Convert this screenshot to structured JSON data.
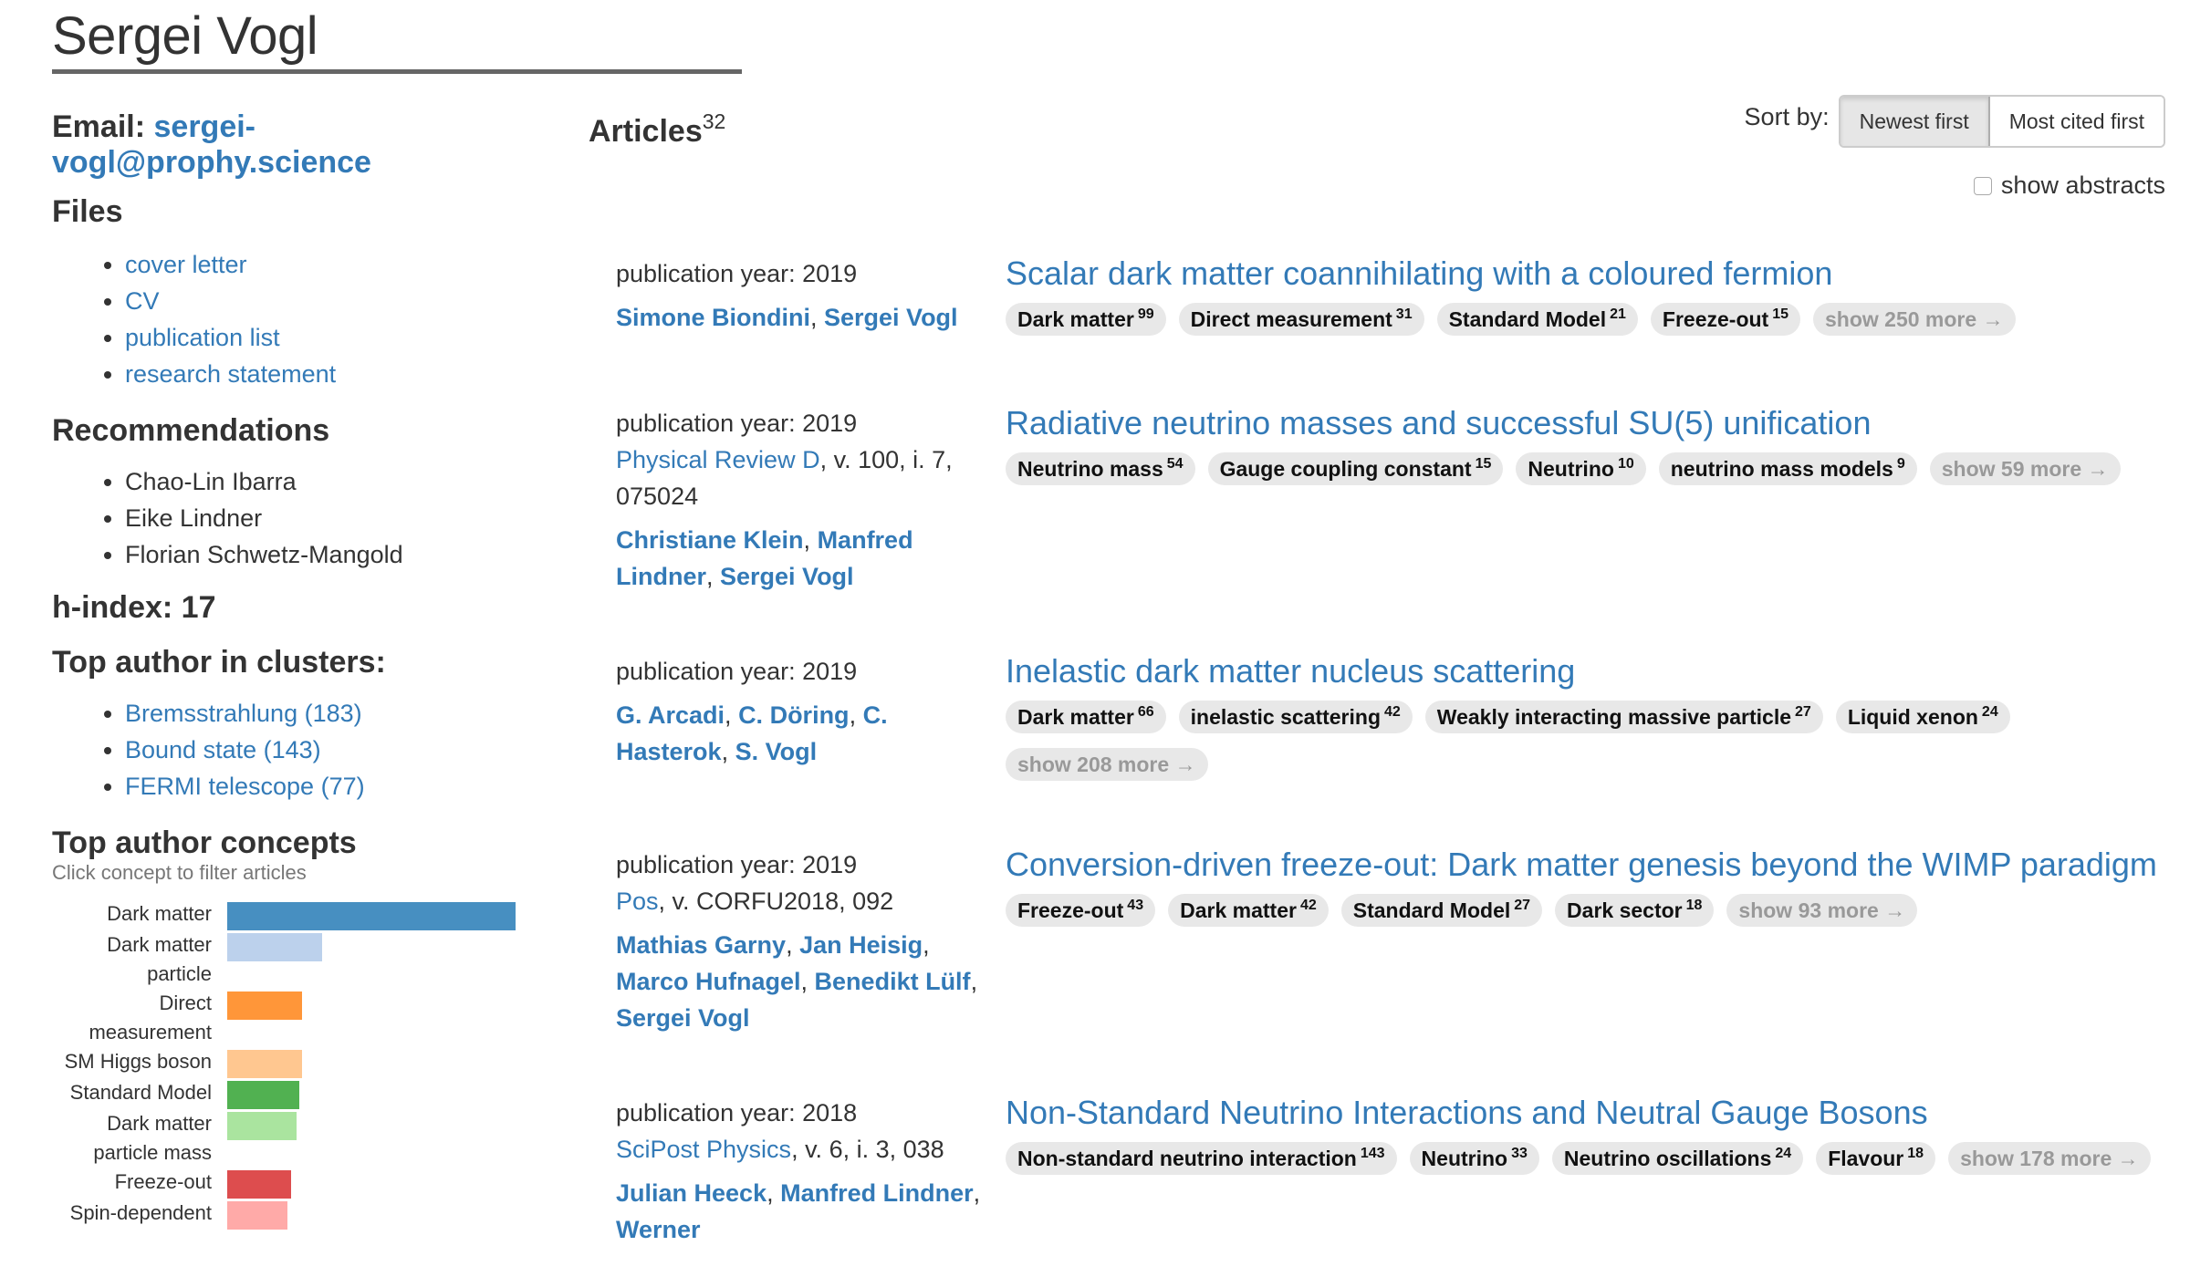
{
  "profile": {
    "name": "Sergei Vogl",
    "email_label": "Email:",
    "email": "sergei-vogl@prophy.science",
    "files_heading": "Files",
    "files": [
      "cover letter",
      "CV",
      "publication list",
      "research statement"
    ],
    "recommendations_heading": "Recommendations",
    "recommendations": [
      "Chao-Lin Ibarra",
      "Eike Lindner",
      "Florian Schwetz-Mangold"
    ],
    "h_index": "h-index: 17",
    "clusters_heading": "Top author in clusters:",
    "clusters": [
      "Bremsstrahlung (183)",
      "Bound state (143)",
      "FERMI telescope (77)"
    ],
    "concepts_heading": "Top author concepts",
    "concepts_hint": "Click concept to filter articles"
  },
  "chart_data": {
    "type": "bar",
    "orientation": "horizontal",
    "title": "Top author concepts",
    "subtitle": "Click concept to filter articles",
    "xlabel": "",
    "ylabel": "",
    "value_unit": "relative share of top concept (%)",
    "categories": [
      "Dark matter",
      "Dark matter particle",
      "Direct measurement",
      "SM Higgs boson",
      "Standard Model",
      "Dark matter particle mass",
      "Freeze-out",
      "Spin-dependent"
    ],
    "values": [
      100,
      33,
      26,
      26,
      25,
      24,
      22,
      21
    ],
    "colors": [
      "#1f77b4",
      "#aec7e8",
      "#ff7f0e",
      "#ffbb78",
      "#2ca02c",
      "#98df8a",
      "#d62728",
      "#ff9896"
    ],
    "grid": false,
    "legend": "none"
  },
  "articles_section": {
    "heading": "Articles",
    "count": "32",
    "sort_label": "Sort by:",
    "sort_options": [
      "Newest first",
      "Most cited first"
    ],
    "sort_selected": "Newest first",
    "abstracts_label": "show abstracts",
    "abstracts_checked": false
  },
  "articles": [
    {
      "year": "publication year: 2019",
      "journal": "",
      "journal_details": "",
      "authors": [
        "Simone Biondini",
        "Sergei Vogl"
      ],
      "title": "Scalar dark matter coannihilating with a coloured fermion",
      "tags": [
        {
          "label": "Dark matter",
          "count": "99"
        },
        {
          "label": "Direct measurement",
          "count": "31"
        },
        {
          "label": "Standard Model",
          "count": "21"
        },
        {
          "label": "Freeze-out",
          "count": "15"
        }
      ],
      "more": "show 250 more →"
    },
    {
      "year": "publication year: 2019",
      "journal": "Physical Review D",
      "journal_details": ", v. 100, i. 7, 075024",
      "authors": [
        "Christiane Klein",
        "Manfred Lindner",
        "Sergei Vogl"
      ],
      "title": "Radiative neutrino masses and successful SU(5) unification",
      "tags": [
        {
          "label": "Neutrino mass",
          "count": "54"
        },
        {
          "label": "Gauge coupling constant",
          "count": "15"
        },
        {
          "label": "Neutrino",
          "count": "10"
        },
        {
          "label": "neutrino mass models",
          "count": "9"
        }
      ],
      "more": "show 59 more →"
    },
    {
      "year": "publication year: 2019",
      "journal": "",
      "journal_details": "",
      "authors": [
        "G. Arcadi",
        "C. Döring",
        "C. Hasterok",
        "S. Vogl"
      ],
      "title": "Inelastic dark matter nucleus scattering",
      "tags": [
        {
          "label": "Dark matter",
          "count": "66"
        },
        {
          "label": "inelastic scattering",
          "count": "42"
        },
        {
          "label": "Weakly interacting massive particle",
          "count": "27"
        },
        {
          "label": "Liquid xenon",
          "count": "24"
        }
      ],
      "more": "show 208 more →"
    },
    {
      "year": "publication year: 2019",
      "journal": "Pos",
      "journal_details": ", v. CORFU2018, 092",
      "authors": [
        "Mathias Garny",
        "Jan Heisig",
        "Marco Hufnagel",
        "Benedikt Lülf",
        "Sergei Vogl"
      ],
      "title": "Conversion-driven freeze-out: Dark matter genesis beyond the WIMP paradigm",
      "tags": [
        {
          "label": "Freeze-out",
          "count": "43"
        },
        {
          "label": "Dark matter",
          "count": "42"
        },
        {
          "label": "Standard Model",
          "count": "27"
        },
        {
          "label": "Dark sector",
          "count": "18"
        }
      ],
      "more": "show 93 more →"
    },
    {
      "year": "publication year: 2018",
      "journal": "SciPost Physics",
      "journal_details": ", v. 6, i. 3, 038",
      "authors": [
        "Julian Heeck",
        "Manfred Lindner",
        "Werner"
      ],
      "title": "Non-Standard Neutrino Interactions and Neutral Gauge Bosons",
      "tags": [
        {
          "label": "Non-standard neutrino interaction",
          "count": "143"
        },
        {
          "label": "Neutrino",
          "count": "33"
        },
        {
          "label": "Neutrino oscillations",
          "count": "24"
        },
        {
          "label": "Flavour",
          "count": "18"
        }
      ],
      "more": "show 178 more →"
    }
  ],
  "colors": {
    "link": "#337ab7",
    "text": "#333333",
    "tag_bg": "#e8e8e8",
    "muted": "#999999"
  }
}
